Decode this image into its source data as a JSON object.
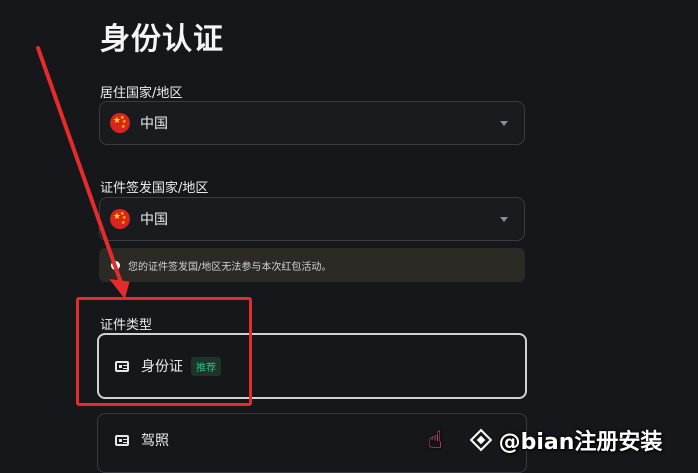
{
  "page": {
    "title": "身份认证"
  },
  "residence": {
    "label": "居住国家/地区",
    "value": "中国"
  },
  "issuing": {
    "label": "证件签发国家/地区",
    "value": "中国"
  },
  "notice": {
    "text": "您的证件签发国/地区无法参与本次红包活动。"
  },
  "document_type": {
    "label": "证件类型",
    "options": [
      {
        "name": "身份证",
        "badge": "推荐"
      },
      {
        "name": "驾照"
      }
    ]
  },
  "watermark": {
    "text": "@bian注册安装"
  },
  "colors": {
    "annotation_red": "#e52b2b",
    "badge_green": "#2ebd85",
    "background": "#16171b"
  },
  "icons": [
    "china-flag-icon",
    "chevron-down-icon",
    "id-card-icon",
    "hand-pointer-icon",
    "binance-logo-icon"
  ]
}
